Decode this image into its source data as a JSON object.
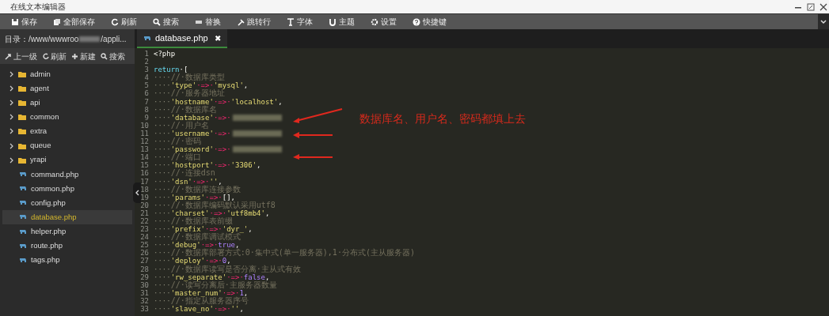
{
  "window": {
    "title": "在线文本编辑器"
  },
  "toolbar": [
    "保存",
    "全部保存",
    "刷新",
    "搜索",
    "替换",
    "跳转行",
    "字体",
    "主题",
    "设置",
    "快捷键"
  ],
  "sidebar": {
    "path": {
      "prefix": "目录：/www/wwwroo",
      "suffix": "/appli..."
    },
    "actions": [
      "上一级",
      "刷新",
      "新建",
      "搜索"
    ],
    "items": [
      {
        "kind": "folder",
        "label": "admin",
        "selected": false
      },
      {
        "kind": "folder",
        "label": "agent",
        "selected": false
      },
      {
        "kind": "folder",
        "label": "api",
        "selected": false
      },
      {
        "kind": "folder",
        "label": "common",
        "selected": false
      },
      {
        "kind": "folder",
        "label": "extra",
        "selected": false
      },
      {
        "kind": "folder",
        "label": "queue",
        "selected": false
      },
      {
        "kind": "folder",
        "label": "yrapi",
        "selected": false
      },
      {
        "kind": "file",
        "label": "command.php",
        "selected": false
      },
      {
        "kind": "file",
        "label": "common.php",
        "selected": false
      },
      {
        "kind": "file",
        "label": "config.php",
        "selected": false
      },
      {
        "kind": "file",
        "label": "database.php",
        "selected": true
      },
      {
        "kind": "file",
        "label": "helper.php",
        "selected": false
      },
      {
        "kind": "file",
        "label": "route.php",
        "selected": false
      },
      {
        "kind": "file",
        "label": "tags.php",
        "selected": false
      }
    ]
  },
  "tabs": [
    {
      "label": "database.php",
      "close": "✖",
      "selected": true
    }
  ],
  "code": [
    {
      "n": "1",
      "tokens": [
        {
          "kind": "plain",
          "text": "<?php"
        }
      ]
    },
    {
      "n": "2"
    },
    {
      "n": "3",
      "tokens": [
        {
          "kind": "kw",
          "text": "return"
        },
        {
          "kind": "plain",
          "text": "·["
        }
      ]
    },
    {
      "n": "4",
      "tokens": [
        {
          "kind": "ws",
          "text": "····"
        },
        {
          "kind": "cm",
          "text": "//·数据库类型"
        }
      ]
    },
    {
      "n": "5",
      "tokens": [
        {
          "kind": "ws",
          "text": "····"
        },
        {
          "kind": "str",
          "text": "'type'"
        },
        {
          "kind": "op",
          "text": "·=>·"
        },
        {
          "kind": "str",
          "text": "'mysql'"
        },
        {
          "kind": "plain",
          "text": ","
        }
      ]
    },
    {
      "n": "6",
      "tokens": [
        {
          "kind": "ws",
          "text": "····"
        },
        {
          "kind": "cm",
          "text": "//·服务器地址"
        }
      ]
    },
    {
      "n": "7",
      "tokens": [
        {
          "kind": "ws",
          "text": "····"
        },
        {
          "kind": "str",
          "text": "'hostname'"
        },
        {
          "kind": "op",
          "text": "·=>·"
        },
        {
          "kind": "str",
          "text": "'localhost'"
        },
        {
          "kind": "plain",
          "text": ","
        }
      ]
    },
    {
      "n": "8",
      "tokens": [
        {
          "kind": "ws",
          "text": "····"
        },
        {
          "kind": "cm",
          "text": "//·数据库名"
        }
      ]
    },
    {
      "n": "9",
      "tokens": [
        {
          "kind": "ws",
          "text": "····"
        },
        {
          "kind": "str",
          "text": "'database'"
        },
        {
          "kind": "op",
          "text": "·=>·"
        },
        {
          "kind": "redacted"
        }
      ]
    },
    {
      "n": "10",
      "tokens": [
        {
          "kind": "ws",
          "text": "····"
        },
        {
          "kind": "cm",
          "text": "//·用户名"
        }
      ]
    },
    {
      "n": "11",
      "tokens": [
        {
          "kind": "ws",
          "text": "····"
        },
        {
          "kind": "str",
          "text": "'username'"
        },
        {
          "kind": "op",
          "text": "·=>·"
        },
        {
          "kind": "redacted"
        }
      ]
    },
    {
      "n": "12",
      "tokens": [
        {
          "kind": "ws",
          "text": "····"
        },
        {
          "kind": "cm",
          "text": "//·密码"
        }
      ]
    },
    {
      "n": "13",
      "tokens": [
        {
          "kind": "ws",
          "text": "····"
        },
        {
          "kind": "str",
          "text": "'password'"
        },
        {
          "kind": "op",
          "text": "·=>·"
        },
        {
          "kind": "redacted"
        }
      ]
    },
    {
      "n": "14",
      "tokens": [
        {
          "kind": "ws",
          "text": "····"
        },
        {
          "kind": "cm",
          "text": "//·端口"
        }
      ]
    },
    {
      "n": "15",
      "tokens": [
        {
          "kind": "ws",
          "text": "····"
        },
        {
          "kind": "str",
          "text": "'hostport'"
        },
        {
          "kind": "op",
          "text": "·=>·"
        },
        {
          "kind": "str",
          "text": "'3306'"
        },
        {
          "kind": "plain",
          "text": ","
        }
      ]
    },
    {
      "n": "16",
      "tokens": [
        {
          "kind": "ws",
          "text": "····"
        },
        {
          "kind": "cm",
          "text": "//·连接dsn"
        }
      ]
    },
    {
      "n": "17",
      "tokens": [
        {
          "kind": "ws",
          "text": "····"
        },
        {
          "kind": "str",
          "text": "'dsn'"
        },
        {
          "kind": "op",
          "text": "·=>·"
        },
        {
          "kind": "str",
          "text": "''"
        },
        {
          "kind": "plain",
          "text": ","
        }
      ]
    },
    {
      "n": "18",
      "tokens": [
        {
          "kind": "ws",
          "text": "····"
        },
        {
          "kind": "cm",
          "text": "//·数据库连接参数"
        }
      ]
    },
    {
      "n": "19",
      "tokens": [
        {
          "kind": "ws",
          "text": "····"
        },
        {
          "kind": "str",
          "text": "'params'"
        },
        {
          "kind": "op",
          "text": "·=>·"
        },
        {
          "kind": "plain",
          "text": "[],"
        }
      ]
    },
    {
      "n": "20",
      "tokens": [
        {
          "kind": "ws",
          "text": "····"
        },
        {
          "kind": "cm",
          "text": "//·数据库编码默认采用utf8"
        }
      ]
    },
    {
      "n": "21",
      "tokens": [
        {
          "kind": "ws",
          "text": "····"
        },
        {
          "kind": "str",
          "text": "'charset'"
        },
        {
          "kind": "op",
          "text": "·=>·"
        },
        {
          "kind": "str",
          "text": "'utf8mb4'"
        },
        {
          "kind": "plain",
          "text": ","
        }
      ]
    },
    {
      "n": "22",
      "tokens": [
        {
          "kind": "ws",
          "text": "····"
        },
        {
          "kind": "cm",
          "text": "//·数据库表前缀"
        }
      ]
    },
    {
      "n": "23",
      "tokens": [
        {
          "kind": "ws",
          "text": "····"
        },
        {
          "kind": "str",
          "text": "'prefix'"
        },
        {
          "kind": "op",
          "text": "·=>·"
        },
        {
          "kind": "str",
          "text": "'dyr_'"
        },
        {
          "kind": "plain",
          "text": ","
        }
      ]
    },
    {
      "n": "24",
      "tokens": [
        {
          "kind": "ws",
          "text": "····"
        },
        {
          "kind": "cm",
          "text": "//·数据库调试模式"
        }
      ]
    },
    {
      "n": "25",
      "tokens": [
        {
          "kind": "ws",
          "text": "····"
        },
        {
          "kind": "str",
          "text": "'debug'"
        },
        {
          "kind": "op",
          "text": "·=>·"
        },
        {
          "kind": "const",
          "text": "true"
        },
        {
          "kind": "plain",
          "text": ","
        }
      ]
    },
    {
      "n": "26",
      "tokens": [
        {
          "kind": "ws",
          "text": "····"
        },
        {
          "kind": "cm",
          "text": "//·数据库部署方式:0·集中式(单一服务器),1·分布式(主从服务器)"
        }
      ]
    },
    {
      "n": "27",
      "tokens": [
        {
          "kind": "ws",
          "text": "····"
        },
        {
          "kind": "str",
          "text": "'deploy'"
        },
        {
          "kind": "op",
          "text": "·=>·"
        },
        {
          "kind": "const",
          "text": "0"
        },
        {
          "kind": "plain",
          "text": ","
        }
      ]
    },
    {
      "n": "28",
      "tokens": [
        {
          "kind": "ws",
          "text": "····"
        },
        {
          "kind": "cm",
          "text": "//·数据库读写是否分离·主从式有效"
        }
      ]
    },
    {
      "n": "29",
      "tokens": [
        {
          "kind": "ws",
          "text": "····"
        },
        {
          "kind": "str",
          "text": "'rw_separate'"
        },
        {
          "kind": "op",
          "text": "·=>·"
        },
        {
          "kind": "const",
          "text": "false"
        },
        {
          "kind": "plain",
          "text": ","
        }
      ]
    },
    {
      "n": "30",
      "tokens": [
        {
          "kind": "ws",
          "text": "····"
        },
        {
          "kind": "cm",
          "text": "//·读写分离后·主服务器数量"
        }
      ]
    },
    {
      "n": "31",
      "tokens": [
        {
          "kind": "ws",
          "text": "····"
        },
        {
          "kind": "str",
          "text": "'master_num'"
        },
        {
          "kind": "op",
          "text": "·=>·"
        },
        {
          "kind": "const",
          "text": "1"
        },
        {
          "kind": "plain",
          "text": ","
        }
      ]
    },
    {
      "n": "32",
      "tokens": [
        {
          "kind": "ws",
          "text": "····"
        },
        {
          "kind": "cm",
          "text": "//·指定从服务器序号"
        }
      ]
    },
    {
      "n": "33",
      "tokens": [
        {
          "kind": "ws",
          "text": "····"
        },
        {
          "kind": "str",
          "text": "'slave_no'"
        },
        {
          "kind": "op",
          "text": "·=>·"
        },
        {
          "kind": "str",
          "text": "''"
        },
        {
          "kind": "plain",
          "text": ","
        }
      ]
    }
  ],
  "annotation": {
    "text": "数据库名、用户名、密码都填上去"
  }
}
